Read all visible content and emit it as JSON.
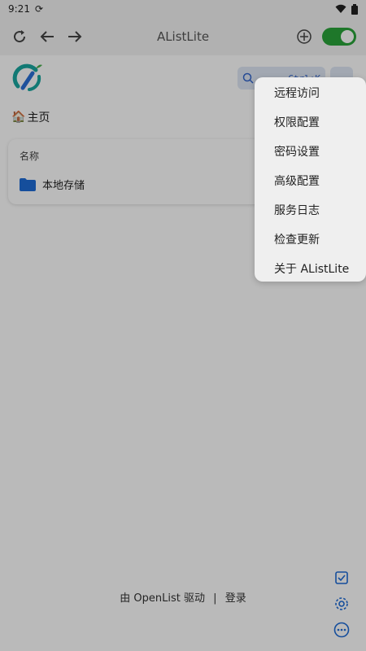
{
  "status_bar": {
    "time": "9:21"
  },
  "app_bar": {
    "title": "AListLite"
  },
  "webview": {
    "search_shortcut": "Ctrl+K",
    "breadcrumb": "主页",
    "table": {
      "header": "名称",
      "rows": [
        {
          "name": "本地存储"
        }
      ]
    },
    "footer": {
      "powered_by": "由 OpenList 驱动",
      "separator": "|",
      "login": "登录"
    }
  },
  "menu": {
    "items": [
      {
        "label": "远程访问"
      },
      {
        "label": "权限配置"
      },
      {
        "label": "密码设置"
      },
      {
        "label": "高级配置"
      },
      {
        "label": "服务日志"
      },
      {
        "label": "检查更新"
      },
      {
        "label": "关于 AListLite"
      }
    ]
  },
  "colors": {
    "accent_green": "#2aa43a",
    "link_blue": "#1e6bd6"
  }
}
